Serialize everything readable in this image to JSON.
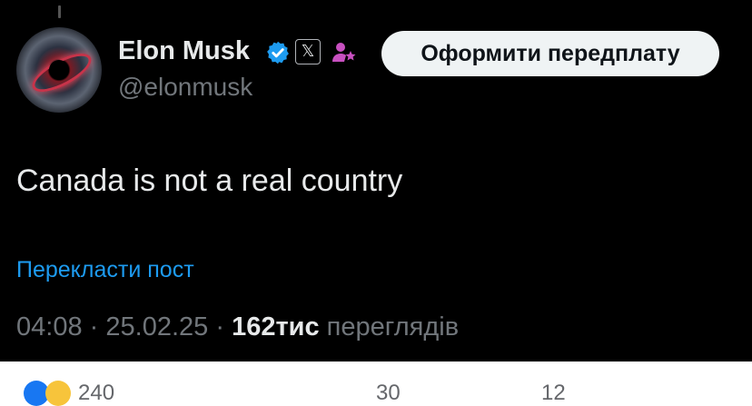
{
  "post": {
    "author_name": "Elon Musk",
    "handle": "@elonmusk",
    "subscribe_label": "Оформити передплату",
    "text": "Canada is not a real country",
    "translate_label": "Перекласти пост",
    "time": "04:08",
    "date": "25.02.25",
    "separator": "·",
    "view_count": "162тис",
    "views_label": "переглядів",
    "x_badge_glyph": "𝕏"
  },
  "icons": {
    "avatar": "avatar-image",
    "verified": "verified-check-icon",
    "x_badge": "x-logo-icon",
    "affiliate": "affiliate-person-icon"
  },
  "colors": {
    "background": "#000000",
    "text_primary": "#e7e9ea",
    "text_secondary": "#71767b",
    "link": "#1d9bf0",
    "verified": "#1d9bf0",
    "button_bg": "#eff3f4",
    "affiliate": "#c850c0"
  },
  "reactions_row": {
    "reaction_count": "240",
    "comments_count": "30",
    "shares_count": "12"
  }
}
